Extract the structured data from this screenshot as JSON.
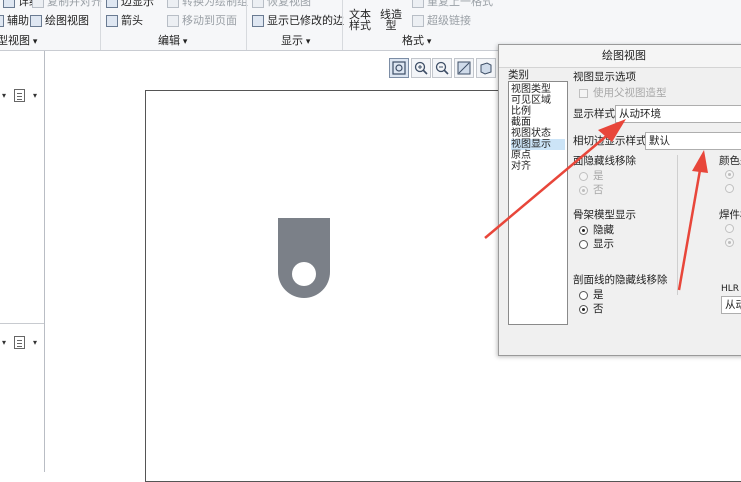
{
  "ribbon": {
    "row1": {
      "detail": "详细",
      "copy_align": "复制并对齐",
      "edge_display": "边显示",
      "convert_draft": "转换为绘制组",
      "restore_view": "恢复视图",
      "text_style": "文本样式",
      "line_style": "线造型",
      "repeat_format": "重复上一格式"
    },
    "row2": {
      "auxiliary": "辅助",
      "drawing_view": "绘图视图",
      "arrow": "箭头",
      "move_to_page": "移动到页面",
      "show_modified_edges": "显示已修改的边",
      "hyperlink": "超级链接"
    },
    "groups": {
      "model_view": "型视图",
      "edit": "编辑",
      "display": "显示",
      "format": "格式"
    }
  },
  "view_toolbar": {
    "icons": [
      "refit-icon",
      "zoom-in-icon",
      "zoom-out-icon",
      "repaint-icon",
      "orient-icon"
    ]
  },
  "dialog": {
    "title": "绘图视图",
    "category_label": "类别",
    "categories": [
      "视图类型",
      "可见区域",
      "比例",
      "截面",
      "视图状态",
      "视图显示",
      "原点",
      "对齐"
    ],
    "selected_category": "视图显示",
    "options_title": "视图显示选项",
    "use_parent_style": "使用父视图造型",
    "display_style_label": "显示样式",
    "display_style_value": "从动环境",
    "tangent_style_label": "相切边显示样式",
    "tangent_style_value": "默认",
    "face_hidden_removal": "面隐藏线移除",
    "skeleton_display": "骨架模型显示",
    "section_hidden_removal": "剖面线的隐藏线移除",
    "yes": "是",
    "no": "否",
    "hide": "隐藏",
    "show": "显示",
    "color_from": "颜色来",
    "weld_parts": "焊件横",
    "hlr": "HLR",
    "hlr_value": "从动",
    "face_hidden_selected": "否",
    "skeleton_selected": "隐藏",
    "section_hidden_selected": "否"
  },
  "colors": {
    "accent_arrow": "#e8463a",
    "part_fill": "#7b8088",
    "selection": "#cce4f7"
  }
}
